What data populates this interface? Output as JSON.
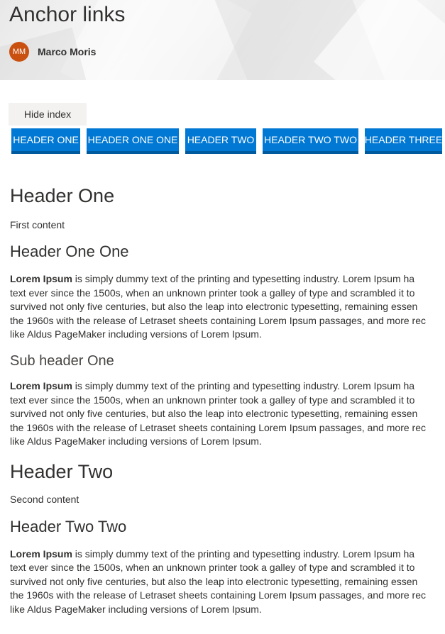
{
  "page": {
    "title": "Anchor links",
    "author": {
      "initials": "MM",
      "name": "Marco Moris",
      "avatar_color": "#ca5010"
    }
  },
  "hide_index_label": "Hide index",
  "nav": {
    "accent": "#0078d4",
    "items": [
      {
        "label": "HEADER ONE"
      },
      {
        "label": "HEADER ONE ONE"
      },
      {
        "label": "HEADER TWO"
      },
      {
        "label": "HEADER TWO TWO"
      },
      {
        "label": "HEADER THREE"
      }
    ]
  },
  "sections": {
    "header_one": {
      "title": "Header One",
      "body": "First content"
    },
    "header_one_one": {
      "title": "Header One One",
      "bold": "Lorem Ipsum",
      "lines": [
        " is simply dummy text of the printing and typesetting industry. Lorem Ipsum ha",
        "text ever since the 1500s, when an unknown printer took a galley of type and scrambled it to",
        "survived not only five centuries, but also the leap into electronic typesetting, remaining essen",
        "the 1960s with the release of Letraset sheets containing Lorem Ipsum passages, and more rec",
        "like Aldus PageMaker including versions of Lorem Ipsum."
      ]
    },
    "sub_header_one": {
      "title": "Sub header One",
      "bold": "Lorem Ipsum",
      "lines": [
        " is simply dummy text of the printing and typesetting industry. Lorem Ipsum ha",
        "text ever since the 1500s, when an unknown printer took a galley of type and scrambled it to",
        "survived not only five centuries, but also the leap into electronic typesetting, remaining essen",
        "the 1960s with the release of Letraset sheets containing Lorem Ipsum passages, and more rec",
        "like Aldus PageMaker including versions of Lorem Ipsum."
      ]
    },
    "header_two": {
      "title": "Header Two",
      "body": "Second content"
    },
    "header_two_two": {
      "title": "Header Two Two",
      "bold": "Lorem Ipsum",
      "lines": [
        " is simply dummy text of the printing and typesetting industry. Lorem Ipsum ha",
        "text ever since the 1500s, when an unknown printer took a galley of type and scrambled it to",
        "survived not only five centuries, but also the leap into electronic typesetting, remaining essen",
        "the 1960s with the release of Letraset sheets containing Lorem Ipsum passages, and more rec",
        "like Aldus PageMaker including versions of Lorem Ipsum."
      ]
    }
  }
}
